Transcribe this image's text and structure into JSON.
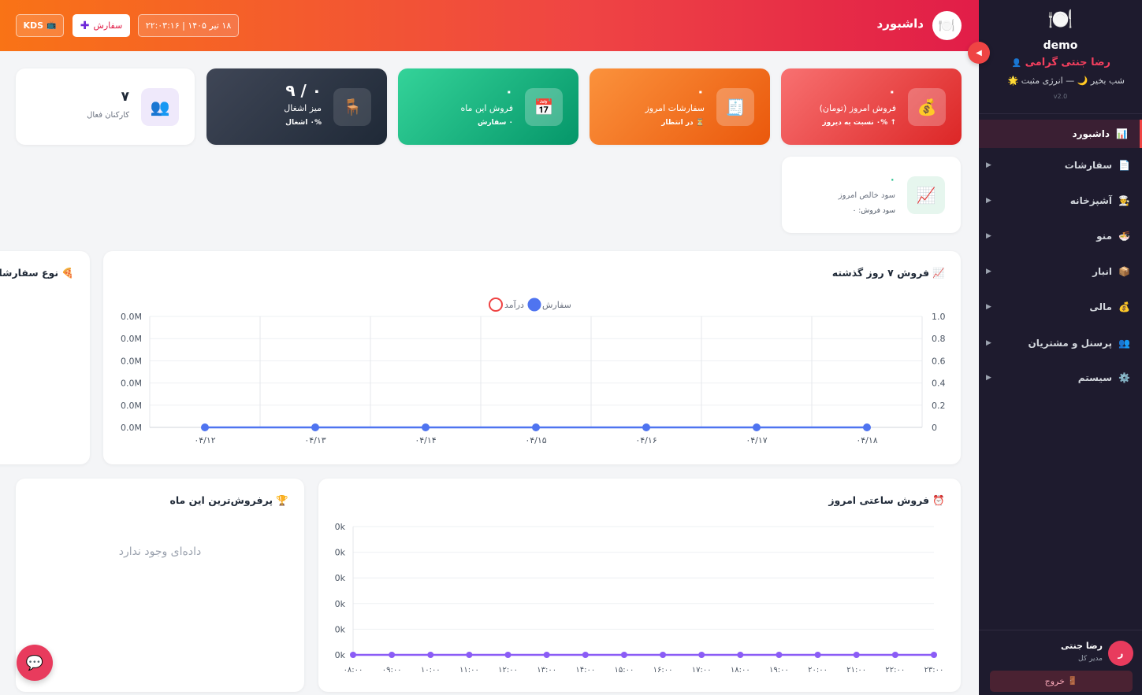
{
  "sidebar": {
    "logo_icon": "🍽️",
    "brand": "demo",
    "user_greeting": "رضا جنتی گرامی",
    "user_icon": "👤",
    "greeting_line": "شب بخیر 🌙 — انرژی مثبت 🌟",
    "version": "v2.0",
    "items": [
      {
        "label": "داشبورد",
        "icon": "📊",
        "active": true
      },
      {
        "label": "سفارشات",
        "icon": "📄"
      },
      {
        "label": "آشپزخانه",
        "icon": "👨‍🍳"
      },
      {
        "label": "منو",
        "icon": "🍜"
      },
      {
        "label": "انبار",
        "icon": "📦"
      },
      {
        "label": "مالی",
        "icon": "💰"
      },
      {
        "label": "پرسنل و مشتریان",
        "icon": "👥"
      },
      {
        "label": "سیستم",
        "icon": "⚙️"
      }
    ],
    "arrow": "▶",
    "footer": {
      "avatar": "ر",
      "name": "رضا جنتی",
      "role": "مدیر کل",
      "logout": "خروج",
      "logout_icon": "🚪"
    }
  },
  "topbar": {
    "logo_icon": "🍽️",
    "title": "داشبورد",
    "datetime": "۱۸ تیر ۱۴۰۵ | ۲۲:۰۳:۱۶",
    "order_button": "سفارش",
    "order_plus": "✚",
    "kds_label": "KDS",
    "kds_icon": "📺",
    "collapse_icon": "◀"
  },
  "stats": [
    {
      "id": "today-sales",
      "value": "۰",
      "label": "فروش امروز (تومان)",
      "sub": "↑ ۰% نسبت به دیروز",
      "icon": "💰"
    },
    {
      "id": "today-orders",
      "value": "۰",
      "label": "سفارشات امروز",
      "sub": "⏳ در انتظار",
      "icon": "🧾"
    },
    {
      "id": "month-sales",
      "value": "۰",
      "label": "فروش این ماه",
      "sub": "۰ سفارش",
      "icon": "📅"
    },
    {
      "id": "tables",
      "value": "۰ / ۹",
      "label": "میز اشغال",
      "sub": "۰% اشغال",
      "icon": "🪑"
    },
    {
      "id": "staff",
      "value": "۷",
      "label": "کارکنان فعال",
      "icon": "👥"
    },
    {
      "id": "net-profit",
      "value": "۰",
      "label": "سود خالص امروز",
      "sub": "سود فروش: ۰",
      "icon": "📈"
    }
  ],
  "colors": {
    "order_line": "#4f74f0",
    "revenue_ring": "#ef4444",
    "hourly_line": "#8b5cf6"
  },
  "sales7": {
    "title": "فروش ۷ روز گذشته",
    "icon": "📈",
    "legend": [
      {
        "name": "سفارش"
      },
      {
        "name": "درآمد"
      }
    ]
  },
  "order_types": {
    "title": "نوع سفارشات",
    "icon": "🍕"
  },
  "hourly": {
    "title": "فروش ساعتی امروز",
    "icon": "⏰"
  },
  "top_sellers": {
    "title": "پرفروش‌ترین این ماه",
    "icon": "🏆",
    "empty": "داده‌ای وجود ندارد"
  },
  "chat_icon": "💬",
  "chart_data": [
    {
      "type": "line",
      "categories": [
        "۰۴/۱۲",
        "۰۴/۱۳",
        "۰۴/۱۴",
        "۰۴/۱۵",
        "۰۴/۱۶",
        "۰۴/۱۷",
        "۰۴/۱۸"
      ],
      "series": [
        {
          "name": "سفارش",
          "values": [
            0,
            0,
            0,
            0,
            0,
            0,
            0
          ]
        },
        {
          "name": "درآمد",
          "values": [
            0,
            0,
            0,
            0,
            0,
            0,
            0
          ]
        }
      ],
      "y_left_ticks": [
        "0.0M",
        "0.0M",
        "0.0M",
        "0.0M",
        "0.0M",
        "0.0M"
      ],
      "y_right_ticks": [
        "1.0",
        "0.8",
        "0.6",
        "0.4",
        "0.2",
        "0"
      ],
      "ylim": [
        0,
        1
      ],
      "grid": true
    },
    {
      "type": "line",
      "categories": [
        "۰۸:۰۰",
        "۰۹:۰۰",
        "۱۰:۰۰",
        "۱۱:۰۰",
        "۱۲:۰۰",
        "۱۳:۰۰",
        "۱۴:۰۰",
        "۱۵:۰۰",
        "۱۶:۰۰",
        "۱۷:۰۰",
        "۱۸:۰۰",
        "۱۹:۰۰",
        "۲۰:۰۰",
        "۲۱:۰۰",
        "۲۲:۰۰",
        "۲۳:۰۰"
      ],
      "series": [
        {
          "values": [
            0,
            0,
            0,
            0,
            0,
            0,
            0,
            0,
            0,
            0,
            0,
            0,
            0,
            0,
            0,
            0
          ]
        }
      ],
      "y_ticks": [
        "0k",
        "0k",
        "0k",
        "0k",
        "0k",
        "0k"
      ],
      "grid": true
    }
  ]
}
